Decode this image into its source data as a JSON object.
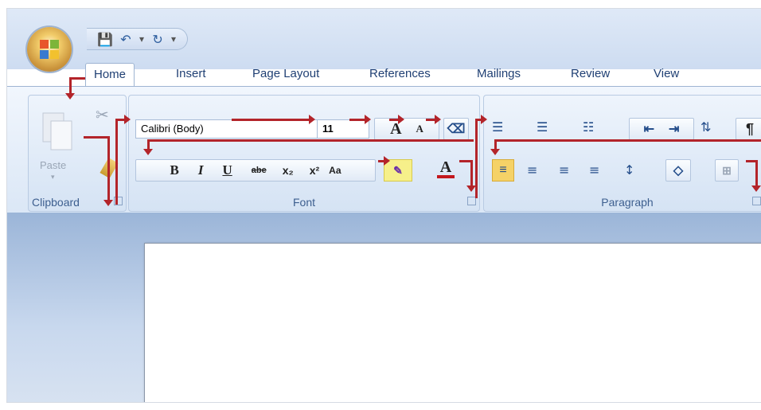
{
  "quick_access": {
    "save_icon": "💾",
    "undo_icon": "↶",
    "redo_icon": "↻",
    "dropdown": "▾"
  },
  "tabs": [
    "Home",
    "Insert",
    "Page Layout",
    "References",
    "Mailings",
    "Review",
    "View"
  ],
  "clipboard": {
    "paste_label": "Paste",
    "group_label": "Clipboard"
  },
  "font": {
    "family_value": "Calibri (Body)",
    "size_value": "11",
    "group_label": "Font",
    "bold": "B",
    "italic": "I",
    "underline": "U",
    "strike": "abe",
    "subscript": "x₂",
    "superscript": "x²",
    "change_case": "Aa",
    "font_color_letter": "A",
    "grow": "A",
    "shrink": "A"
  },
  "paragraph": {
    "group_label": "Paragraph",
    "pilcrow": "¶"
  }
}
